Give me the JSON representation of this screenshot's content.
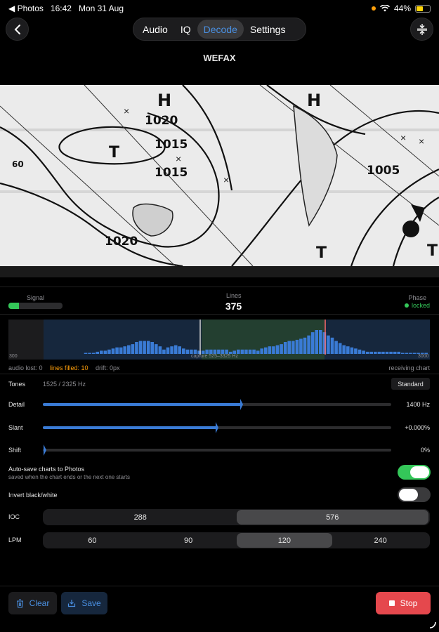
{
  "status_bar": {
    "back_app": "Photos",
    "time": "16:42",
    "date": "Mon 31 Aug",
    "battery": "44%"
  },
  "nav": {
    "tabs": [
      {
        "label": "Audio",
        "active": false
      },
      {
        "label": "IQ",
        "active": false
      },
      {
        "label": "Decode",
        "active": true
      },
      {
        "label": "Settings",
        "active": false
      }
    ],
    "back_icon": "chevron-left-icon",
    "right_icon": "compress-vertical-icon"
  },
  "page_title": "WEFAX",
  "wefax_chart": {
    "labels": [
      "H",
      "H",
      "T",
      "T",
      "T",
      "1020",
      "1015",
      "1015",
      "1020",
      "1005",
      "60"
    ]
  },
  "metrics": {
    "signal_label": "Signal",
    "signal_level": 0.2,
    "lines_label": "Lines",
    "lines_value": "375",
    "phase_label": "Phase",
    "phase_value": "locked"
  },
  "spectrum": {
    "axis_min": "300",
    "axis_caption": "capture 525–3325 Hz",
    "axis_max": "3000",
    "bins": [
      0,
      0,
      0,
      0,
      0,
      0,
      0,
      0,
      0,
      0,
      1,
      1,
      1,
      2,
      3,
      3,
      4,
      5,
      6,
      6,
      7,
      8,
      9,
      11,
      12,
      12,
      12,
      11,
      9,
      7,
      4,
      6,
      7,
      8,
      7,
      5,
      4,
      4,
      4,
      3,
      3,
      4,
      4,
      4,
      4,
      4,
      4,
      2,
      3,
      4,
      4,
      4,
      4,
      4,
      3,
      5,
      6,
      7,
      7,
      8,
      9,
      11,
      12,
      12,
      13,
      14,
      15,
      17,
      20,
      22,
      22,
      20,
      17,
      15,
      12,
      10,
      8,
      7,
      6,
      5,
      4,
      3,
      2,
      2,
      2,
      2,
      2,
      2,
      2,
      2,
      2,
      1,
      1,
      1,
      1,
      1,
      1,
      1
    ],
    "bins_max": 22
  },
  "info": {
    "audio_lost": "audio lost: 0",
    "lines_filled": "lines filled: 10",
    "drift": "drift: 0px",
    "state": "receiving chart"
  },
  "tones": {
    "label": "Tones",
    "value": "1525 / 2325 Hz",
    "button": "Standard"
  },
  "detail": {
    "label": "Detail",
    "value": "1400 Hz",
    "level": 0.57
  },
  "slant": {
    "label": "Slant",
    "value": "+0.000%",
    "level": 0.5
  },
  "shift": {
    "label": "Shift",
    "value": "0%",
    "level": 0.0
  },
  "autosave": {
    "label": "Auto-save charts to Photos",
    "sub": "saved when the chart ends or the next one starts",
    "on": true
  },
  "invert": {
    "label": "Invert black/white",
    "on": false
  },
  "ioc": {
    "label": "IOC",
    "options": [
      "288",
      "576"
    ],
    "selected": "576"
  },
  "lpm": {
    "label": "LPM",
    "options": [
      "60",
      "90",
      "120",
      "240"
    ],
    "selected": "120"
  },
  "actions": {
    "clear": "Clear",
    "save": "Save",
    "stop": "Stop"
  },
  "colors": {
    "accent": "#4a90e2",
    "green": "#34c759",
    "orange": "#ff9f0a",
    "stop": "#e5484d"
  }
}
